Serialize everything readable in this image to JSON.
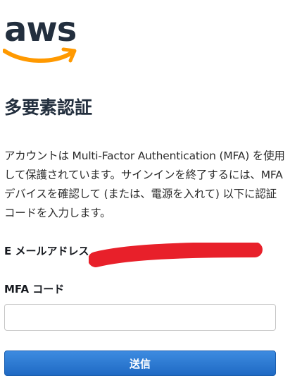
{
  "brand": {
    "logo_text": "aws",
    "logo_color": "#232f3e",
    "smile_color": "#ff9900"
  },
  "page": {
    "title": "多要素認証",
    "description": "アカウントは Multi-Factor Authentication (MFA) を使用して保護されています。サインインを終了するには、MFA デバイスを確認して (または、電源を入れて) 以下に認証コードを入力します。"
  },
  "form": {
    "email_label": "E メールアドレス",
    "mfa_label": "MFA コード",
    "mfa_value": "",
    "submit_label": "送信",
    "button_color": "#1f6ac4"
  },
  "redaction_color": "#e8202a"
}
